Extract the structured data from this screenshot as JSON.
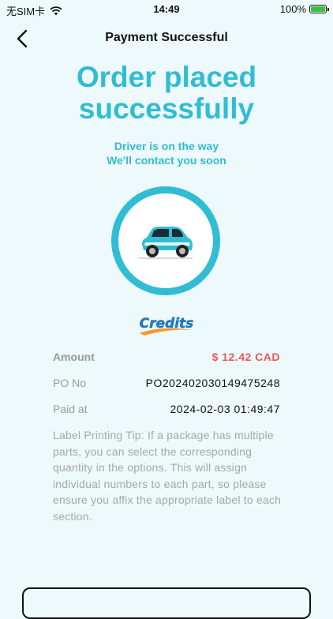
{
  "status_bar": {
    "carrier": "无SIM卡",
    "time": "14:49",
    "battery": "100%"
  },
  "nav": {
    "title": "Payment Successful",
    "back_icon": "chevron-left-icon"
  },
  "hero": {
    "line1": "Order placed",
    "line2": "successfully",
    "sub1": "Driver is on the way",
    "sub2": "We'll contact you soon"
  },
  "logo_text": "Credits",
  "details": {
    "amount_label": "Amount",
    "amount_value": "$ 12.42 CAD",
    "po_label": "PO No",
    "po_value": "PO202402030149475248",
    "paid_label": "Paid at",
    "paid_value": "2024-02-03 01:49:47"
  },
  "tip": "Label Printing Tip: If a package has multiple parts, you can select the corresponding quantity in the options. This will assign individual numbers to each part, so please ensure you affix the appropriate label to each section.",
  "colors": {
    "accent": "#30bdd3",
    "amount": "#e75a57",
    "background": "#eef9fc"
  }
}
